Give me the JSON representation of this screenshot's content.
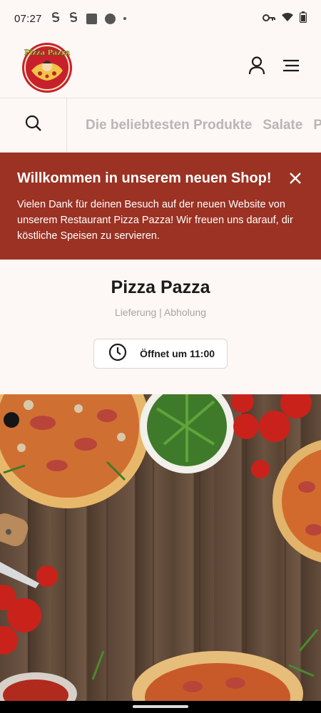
{
  "status_bar": {
    "time": "07:27",
    "left_icons": [
      "app-s-icon",
      "app-s-icon",
      "square-icon",
      "circle-app-icon",
      "dot-icon"
    ],
    "right_icons": [
      "key-icon",
      "wifi-icon",
      "battery-icon"
    ]
  },
  "header": {
    "logo_text": "Pizza Pazza",
    "account_icon": "person-icon",
    "menu_icon": "hamburger-menu-icon"
  },
  "category_nav": {
    "search_icon": "search-icon",
    "items": [
      "Die beliebtesten Produkte",
      "Salate",
      "Piz"
    ]
  },
  "banner": {
    "title": "Willkommen in unserem neuen Shop!",
    "text": "Vielen Dank für deinen Besuch auf der neuen Website von unserem Restaurant Pizza Pazza! Wir freuen uns darauf, dir köstliche Speisen zu servieren.",
    "close_icon": "close-icon",
    "background_color": "#9b3223"
  },
  "store": {
    "name": "Pizza Pazza",
    "modes": "Lieferung | Abholung",
    "opening_label": "Öffnet um 11:00",
    "clock_icon": "clock-icon"
  },
  "colors": {
    "accent": "#9b3223",
    "page_background": "#fdf7f5",
    "muted_text": "#a8a4a3"
  }
}
